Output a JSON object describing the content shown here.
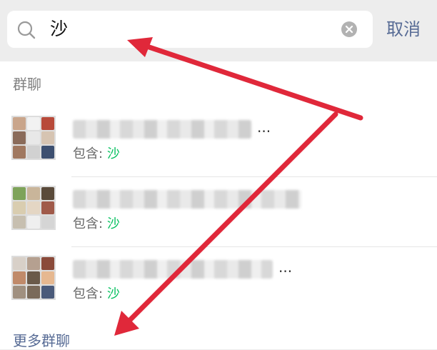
{
  "search": {
    "value": "沙",
    "cancel_label": "取消"
  },
  "section": {
    "title": "群聊",
    "more_label": "更多群聊"
  },
  "groups": [
    {
      "contains_label": "包含:",
      "match": "沙",
      "name_tail": "..."
    },
    {
      "contains_label": "包含:",
      "match": "沙",
      "name_tail": ""
    },
    {
      "contains_label": "包含:",
      "match": "沙",
      "name_tail": "..."
    }
  ],
  "colors": {
    "link": "#576b95",
    "highlight": "#07c160",
    "annotation_arrow": "#e0283a"
  }
}
